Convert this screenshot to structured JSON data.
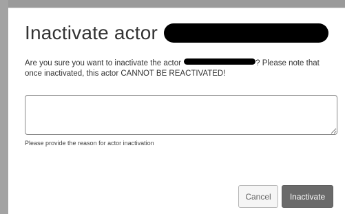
{
  "dialog": {
    "title": "Inactivate actor",
    "message_part1": "Are you sure you want to inactivate the actor ",
    "message_part2": "? Please note that once inactivated, this actor CANNOT BE REACTIVATED!",
    "reason": {
      "value": "",
      "help_text": "Please provide the reason for actor inactivation"
    },
    "buttons": {
      "cancel_label": "Cancel",
      "inactivate_label": "Inactivate"
    }
  },
  "colors": {
    "backdrop": "#9a9a9a",
    "primary_button": "#6a6a6a",
    "redaction": "#000000"
  }
}
